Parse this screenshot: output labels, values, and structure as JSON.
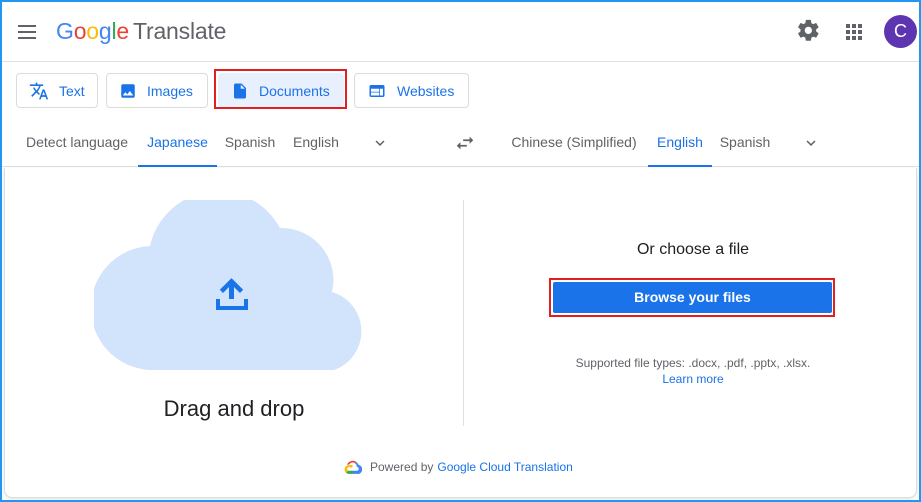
{
  "header": {
    "logo_letters": [
      "G",
      "o",
      "o",
      "g",
      "l",
      "e"
    ],
    "product": "Translate",
    "avatar_initial": "C",
    "icons": {
      "menu": "hamburger-icon",
      "settings": "gear-icon",
      "apps": "apps-grid-icon"
    }
  },
  "modes": [
    {
      "label": "Text",
      "icon": "translate-icon",
      "active": false
    },
    {
      "label": "Images",
      "icon": "image-icon",
      "active": false
    },
    {
      "label": "Documents",
      "icon": "document-icon",
      "active": true
    },
    {
      "label": "Websites",
      "icon": "web-icon",
      "active": false
    }
  ],
  "source_languages": [
    "Detect language",
    "Japanese",
    "Spanish",
    "English"
  ],
  "source_selected": "Japanese",
  "target_languages": [
    "Chinese (Simplified)",
    "English",
    "Spanish"
  ],
  "target_selected": "English",
  "upload": {
    "drag_label": "Drag and drop",
    "choose_label": "Or choose a file",
    "browse_label": "Browse your files",
    "supported_label": "Supported file types: .docx, .pdf, .pptx, .xlsx.",
    "learn_more": "Learn more"
  },
  "footer": {
    "powered_by": "Powered by",
    "service": "Google Cloud Translation"
  },
  "colors": {
    "accent": "#1a73e8",
    "cloud_fill": "#d2e3fc",
    "highlight": "#e02020",
    "avatar": "#5e35b1"
  }
}
